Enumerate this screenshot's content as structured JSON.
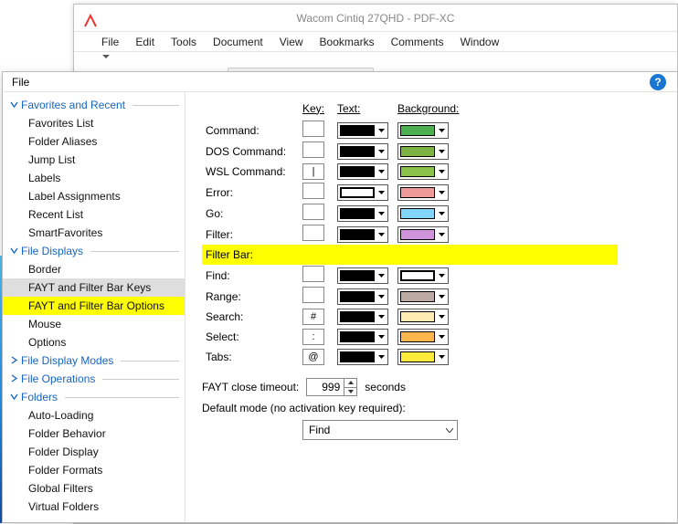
{
  "host": {
    "title": "Wacom Cintiq 27QHD - PDF-XC",
    "menu": [
      "File",
      "Edit",
      "Tools",
      "Document",
      "View",
      "Bookmarks",
      "Comments",
      "Window"
    ]
  },
  "dialog": {
    "title": "File"
  },
  "sidebar": {
    "groups": [
      {
        "label": "Favorites and Recent",
        "expanded": true,
        "items": [
          "Favorites List",
          "Folder Aliases",
          "Jump List",
          "Labels",
          "Label Assignments",
          "Recent List",
          "SmartFavorites"
        ]
      },
      {
        "label": "File Displays",
        "expanded": true,
        "items": [
          "Border",
          "FAYT and Filter Bar Keys",
          "FAYT and Filter Bar Options",
          "Mouse",
          "Options"
        ]
      },
      {
        "label": "File Display Modes",
        "expanded": false,
        "items": []
      },
      {
        "label": "File Operations",
        "expanded": false,
        "items": []
      },
      {
        "label": "Folders",
        "expanded": true,
        "items": [
          "Auto-Loading",
          "Folder Behavior",
          "Folder Display",
          "Folder Formats",
          "Global Filters",
          "Virtual Folders"
        ]
      }
    ],
    "selected_grey": "FAYT and Filter Bar Keys",
    "selected_yellow": "FAYT and Filter Bar Options"
  },
  "headers": {
    "key": "Key:",
    "text": "Text:",
    "bg": "Background:"
  },
  "rows": [
    {
      "label": "Command:",
      "key": "",
      "text": "#000000",
      "bg": "#4CAF50"
    },
    {
      "label": "DOS Command:",
      "key": "",
      "text": "#000000",
      "bg": "#7CB342"
    },
    {
      "label": "WSL Command:",
      "key": "|",
      "text": "#000000",
      "bg": "#8BC34A"
    },
    {
      "label": "Error:",
      "key": "",
      "text_border_only": true,
      "bg": "#EF9A9A"
    },
    {
      "label": "Go:",
      "key": "",
      "text": "#000000",
      "bg": "#81D4FA"
    },
    {
      "label": "Filter:",
      "key": "",
      "text": "#000000",
      "bg": "#CE93D8"
    },
    {
      "label": "Filter Bar:",
      "highlight": true
    },
    {
      "label": "Find:",
      "key": "",
      "text": "#000000",
      "bg_border_only": true
    },
    {
      "label": "Range:",
      "key": "",
      "text": "#000000",
      "bg": "#BCAAA4"
    },
    {
      "label": "Search:",
      "key": "#",
      "text": "#000000",
      "bg": "#FFECB3"
    },
    {
      "label": "Select:",
      "key": ":",
      "text": "#000000",
      "bg": "#FFB74D"
    },
    {
      "label": "Tabs:",
      "key": "@",
      "text": "#000000",
      "bg": "#FFEB3B"
    }
  ],
  "footer": {
    "timeout_label": "FAYT close timeout:",
    "timeout_value": "999",
    "timeout_unit": "seconds",
    "default_mode_label": "Default mode (no activation key required):",
    "default_mode_value": "Find"
  }
}
